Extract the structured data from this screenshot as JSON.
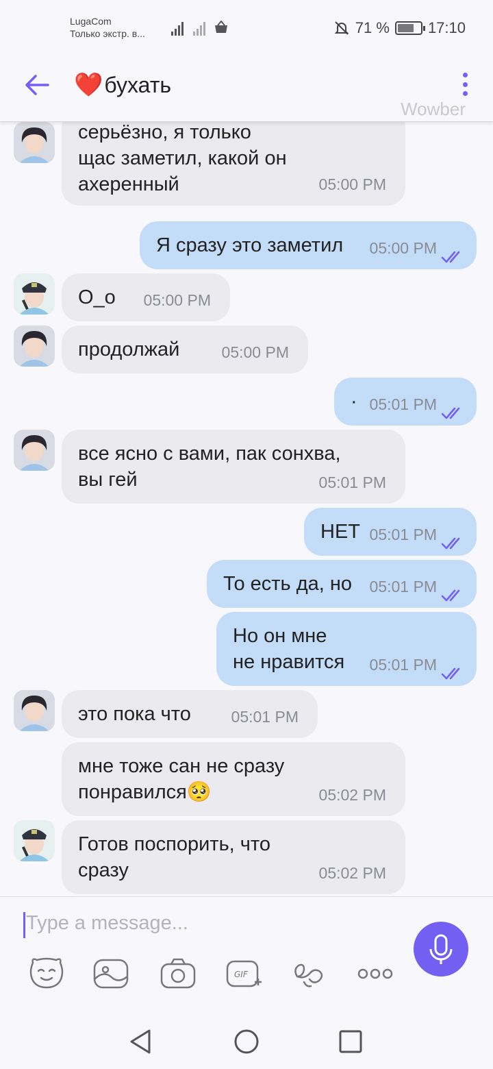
{
  "status_bar": {
    "carrier": "LugaCom",
    "network_status": "Только экстр. в...",
    "battery_percent": "71 %",
    "battery_level": 0.71,
    "time": "17:10"
  },
  "header": {
    "heart": "❤️",
    "title": "бухать",
    "watermark": "Wowber"
  },
  "messages": [
    {
      "dir": "in",
      "avatar": "guitar",
      "lines": [
        "серьёзно, я только",
        "щас заметил, какой он",
        "ахеренный"
      ],
      "time": "05:00 PM"
    },
    {
      "dir": "out",
      "lines": [
        "Я сразу это заметил"
      ],
      "time": "05:00 PM",
      "read": true
    },
    {
      "dir": "in",
      "avatar": "cap",
      "lines": [
        "О_о"
      ],
      "time": "05:00 PM"
    },
    {
      "dir": "in",
      "avatar": "guitar",
      "lines": [
        "продолжай"
      ],
      "time": "05:00 PM"
    },
    {
      "dir": "out",
      "lines": [
        "·"
      ],
      "time": "05:01 PM",
      "read": true
    },
    {
      "dir": "in",
      "avatar": "guitar",
      "lines": [
        "все ясно с вами, пак сонхва,",
        "вы гей"
      ],
      "time": "05:01 PM"
    },
    {
      "dir": "out",
      "lines": [
        "НЕТ"
      ],
      "time": "05:01 PM",
      "read": true
    },
    {
      "dir": "out",
      "lines": [
        "То есть да, но"
      ],
      "time": "05:01 PM",
      "read": true
    },
    {
      "dir": "out",
      "lines": [
        "Но он мне",
        "не нравится"
      ],
      "time": "05:01 PM",
      "read": true
    },
    {
      "dir": "in",
      "avatar": "guitar",
      "lines": [
        "это пока что"
      ],
      "time": "05:01 PM"
    },
    {
      "dir": "in",
      "avatar": "",
      "lines": [
        "мне тоже сан не сразу",
        "понравился🥺"
      ],
      "time": "05:02 PM"
    },
    {
      "dir": "in",
      "avatar": "cap",
      "lines": [
        "Готов поспорить, что",
        "сразу"
      ],
      "time": "05:02 PM"
    }
  ],
  "composer": {
    "placeholder": "Type a message..."
  },
  "toolbar": [
    "sticker-icon",
    "gallery-icon",
    "camera-icon",
    "gif-icon",
    "doodle-icon",
    "more-icon"
  ],
  "colors": {
    "accent": "#7360f2",
    "incoming_bubble": "#ebeaee",
    "outgoing_bubble": "#c3dcf7",
    "heart": "#e0232e"
  }
}
